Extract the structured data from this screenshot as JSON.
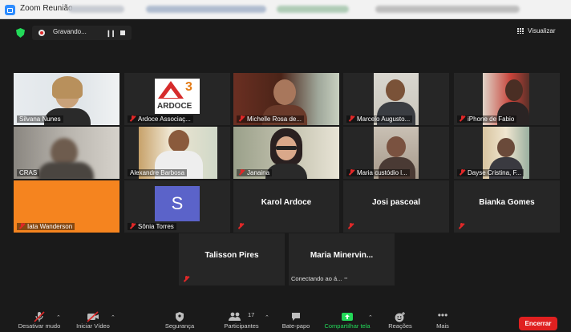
{
  "window": {
    "title": "Zoom Reunião"
  },
  "meeting": {
    "recording_label": "Gravando...",
    "view_label": "Visualizar"
  },
  "tiles": [
    {
      "name": "Silvana Nunes",
      "muted": false
    },
    {
      "name": "Ardoce Associaç...",
      "muted": true,
      "logo_text": "ARDOCE",
      "logo_number": "3"
    },
    {
      "name": "Michelle Rosa de...",
      "muted": true
    },
    {
      "name": "Marcelo Augusto...",
      "muted": true
    },
    {
      "name": "iPhone de Fabio",
      "muted": true
    },
    {
      "name": "CRAS",
      "muted": false
    },
    {
      "name": "Alexandre Barbosa",
      "muted": false
    },
    {
      "name": "Janaina",
      "muted": true
    },
    {
      "name": "Maria custódio l...",
      "muted": true
    },
    {
      "name": "Dayse Cristina, F...",
      "muted": true
    },
    {
      "name": "Iata Wanderson",
      "muted": true
    },
    {
      "name": "Sônia Torres",
      "muted": true,
      "avatar_letter": "S"
    },
    {
      "name": "Karol Ardoce",
      "muted": true
    },
    {
      "name": "Josi pascoal",
      "muted": true
    },
    {
      "name": "Bianka Gomes",
      "muted": true
    },
    {
      "name": "Talisson Pires",
      "muted": true
    },
    {
      "name": "Maria  Minervin...",
      "status": "Conectando ao á..."
    }
  ],
  "toolbar": {
    "mute": "Desativar mudo",
    "video": "Iniciar Vídeo",
    "security": "Segurança",
    "participants": "Participantes",
    "participants_count": "17",
    "chat": "Bate-papo",
    "share": "Compartilhar tela",
    "reactions": "Reações",
    "more": "Mais",
    "end": "Encerrar"
  },
  "colors": {
    "accent": "#2d8cff",
    "share_green": "#23d959",
    "end_red": "#e02020",
    "active_border": "#c8f05a",
    "orange_tile": "#f5841f",
    "avatar_purple": "#5b63c9"
  }
}
